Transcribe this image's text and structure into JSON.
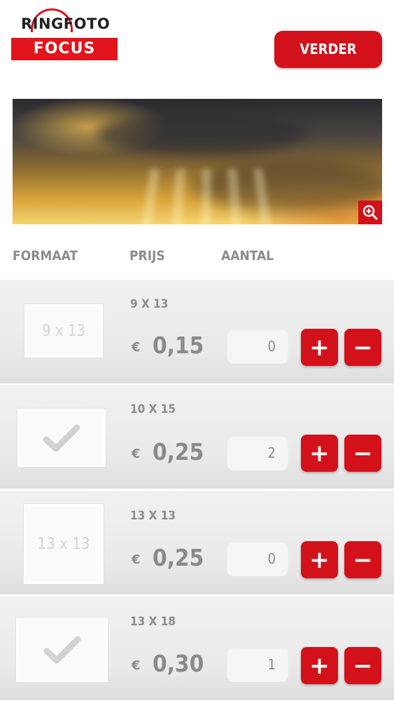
{
  "header": {
    "logo_top": "RINGFOTO",
    "logo_bottom": "FOCUS",
    "next_button": "VERDER"
  },
  "columns": {
    "format": "FORMAAT",
    "price": "PRIJS",
    "quantity": "AANTAL"
  },
  "currency": "€",
  "rows": [
    {
      "size": "9 X 13",
      "thumb_label": "9 x 13",
      "thumb_checked": false,
      "price": "0,15",
      "quantity": "0"
    },
    {
      "size": "10 X 15",
      "thumb_label": "",
      "thumb_checked": true,
      "price": "0,25",
      "quantity": "2"
    },
    {
      "size": "13 X 13",
      "thumb_label": "13 x 13",
      "thumb_checked": false,
      "price": "0,25",
      "quantity": "0"
    },
    {
      "size": "13 X 18",
      "thumb_label": "",
      "thumb_checked": true,
      "price": "0,30",
      "quantity": "1"
    }
  ],
  "buttons": {
    "plus": "+",
    "minus": "−"
  },
  "icons": {
    "zoom": "zoom-in-icon",
    "check": "checkmark-icon"
  },
  "colors": {
    "brand_red": "#d2111b",
    "text_gray": "#8c8c8c"
  }
}
